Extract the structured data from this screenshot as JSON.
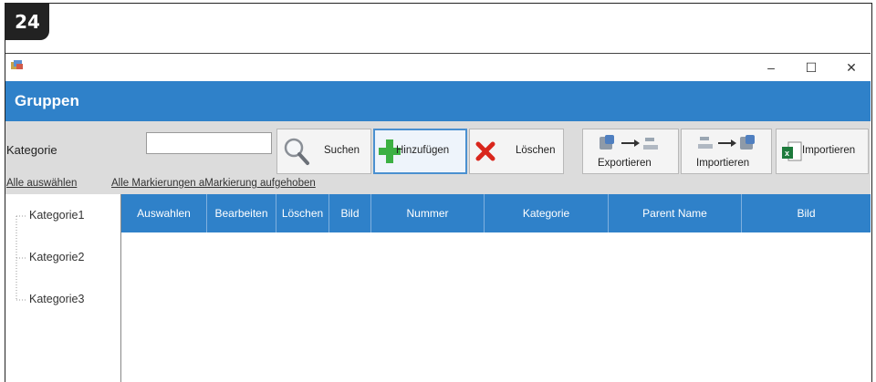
{
  "page_badge": "24",
  "window": {
    "controls": {
      "minimize": "–",
      "maximize": "☐",
      "close": "✕"
    }
  },
  "header": {
    "title": "Gruppen"
  },
  "toolbar": {
    "category_label": "Kategorie",
    "search_value": "",
    "select_all_link": "Alle auswählen",
    "unselect_link": "Alle Markierungen aMarkierung aufgehoben",
    "buttons": {
      "search": "Suchen",
      "add": "Hinzufügen",
      "delete": "Löschen",
      "export": "Exportieren",
      "import": "Importieren",
      "import_excel": "Importieren"
    }
  },
  "tree": {
    "items": [
      "Kategorie1",
      "Kategorie2",
      "Kategorie3"
    ]
  },
  "grid": {
    "columns": [
      "Auswahlen",
      "Bearbeiten",
      "Löschen",
      "Bild",
      "Nummer",
      "Kategorie",
      "Parent Name",
      "Bild"
    ]
  },
  "colors": {
    "accent": "#2f81c9",
    "toolbar_bg": "#dcdcdc",
    "add_green": "#3cb043",
    "delete_red": "#d9261c",
    "excel_green": "#1d7a3c"
  }
}
